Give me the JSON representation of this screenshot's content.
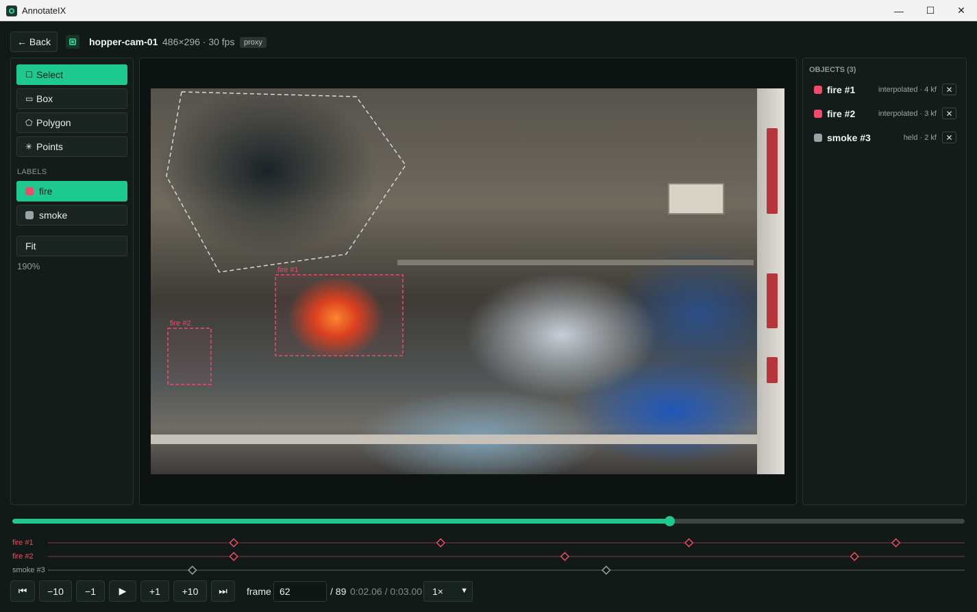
{
  "window": {
    "title": "AnnotateIX",
    "minimize": "—",
    "maximize": "☐",
    "close": "✕"
  },
  "header": {
    "back_label": "← Back",
    "file_name": "hopper-cam-01",
    "file_meta": "486×296 · 30 fps",
    "badge": "proxy"
  },
  "tools": [
    {
      "icon": "☐",
      "label": "Select",
      "active": true
    },
    {
      "icon": "▭",
      "label": "Box",
      "active": false
    },
    {
      "icon": "⬠",
      "label": "Polygon",
      "active": false
    },
    {
      "icon": "✳",
      "label": "Points",
      "active": false
    }
  ],
  "labels_section": {
    "heading": "LABELS",
    "items": [
      {
        "label": "fire",
        "color": "#f04b6a",
        "active": true
      },
      {
        "label": "smoke",
        "color": "#9aa3a8",
        "active": false
      }
    ]
  },
  "zoom": {
    "fit_label": "Fit",
    "level": "190%"
  },
  "canvas": {
    "annotations": [
      {
        "label": "fire #1",
        "color": "#f04b6a"
      },
      {
        "label": "fire #2",
        "color": "#f04b6a"
      }
    ]
  },
  "objects": {
    "heading": "OBJECTS (3)",
    "items": [
      {
        "name": "fire #1",
        "color": "#f04b6a",
        "status": "interpolated · 4 kf",
        "close": "✕"
      },
      {
        "name": "fire #2",
        "color": "#f04b6a",
        "status": "interpolated · 3 kf",
        "close": "✕"
      },
      {
        "name": "smoke #3",
        "color": "#9aa3a8",
        "status": "held · 2 kf",
        "close": "✕"
      }
    ]
  },
  "timeline": {
    "current_frame": 62,
    "total_frames": 89,
    "progress": 0.69,
    "tracks": [
      {
        "name": "fire #1",
        "color": "#f04b6a",
        "keyframes": [
          15,
          40,
          70,
          95
        ]
      },
      {
        "name": "fire #2",
        "color": "#f04b6a",
        "keyframes": [
          15,
          55,
          90
        ]
      },
      {
        "name": "smoke #3",
        "color": "#9aa3a8",
        "keyframes": [
          10,
          60
        ]
      }
    ]
  },
  "controls": {
    "first": "⏮",
    "minus10": "−10",
    "minus1": "−1",
    "play": "▶",
    "plus1": "+1",
    "plus10": "+10",
    "last": "⏭",
    "frame_label": "frame",
    "frame_value": "62",
    "total": "/ 89",
    "time": "0:02.06 / 0:03.00",
    "speed": "1×"
  }
}
